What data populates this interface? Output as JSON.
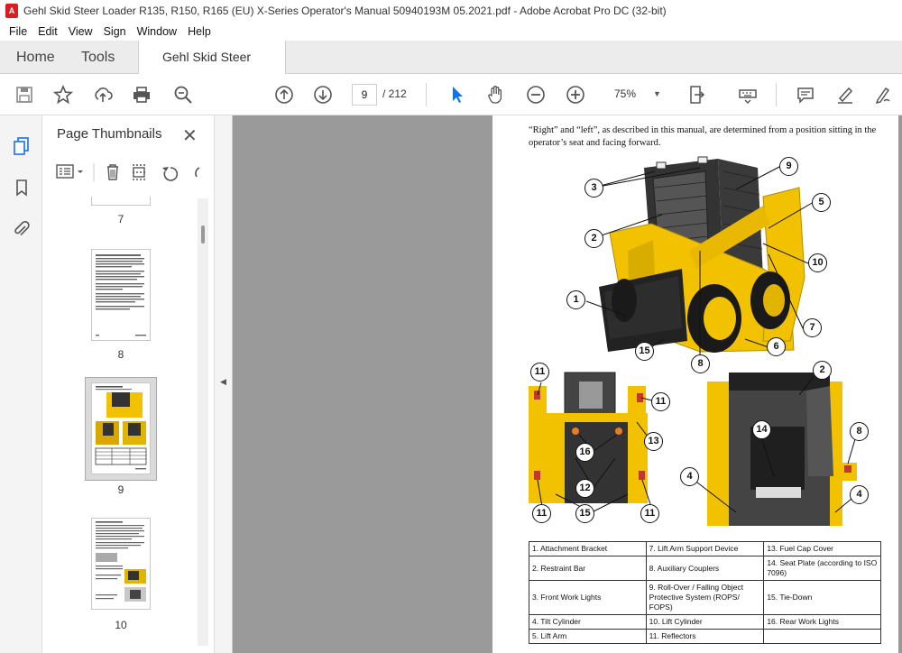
{
  "window": {
    "title": "Gehl Skid Steer Loader R135, R150, R165 (EU) X-Series Operator's Manual 50940193M 05.2021.pdf - Adobe Acrobat Pro DC (32-bit)"
  },
  "menu": [
    "File",
    "Edit",
    "View",
    "Sign",
    "Window",
    "Help"
  ],
  "tabs": {
    "home": "Home",
    "tools": "Tools",
    "document": "Gehl Skid Steer Loa..."
  },
  "toolbar": {
    "current_page": "9",
    "total_pages": "/  212",
    "zoom": "75%"
  },
  "thumbnails": {
    "title": "Page Thumbnails",
    "pages": [
      "7",
      "8",
      "9",
      "10"
    ],
    "selected": "9"
  },
  "document": {
    "intro": "“Right” and “left”, as described in this manual, are determined from a position sitting in the operator’s seat and facing forward.",
    "callouts_top": [
      "3",
      "9",
      "2",
      "5",
      "10",
      "1",
      "7",
      "6",
      "15",
      "8"
    ],
    "callouts_bottom_left": [
      "11",
      "11",
      "13",
      "16",
      "12",
      "11",
      "15",
      "11"
    ],
    "callouts_bottom_right": [
      "2",
      "14",
      "8",
      "4",
      "4"
    ],
    "parts_table": [
      [
        "1. Attachment Bracket",
        "7. Lift Arm Support Device",
        "13. Fuel Cap Cover"
      ],
      [
        "2. Restraint Bar",
        "8. Auxiliary Couplers",
        "14. Seat Plate (according to ISO 7096)"
      ],
      [
        "3. Front Work Lights",
        "9. Roll-Over / Falling Object Protective System (ROPS/ FOPS)",
        "15. Tie-Down"
      ],
      [
        "4. Tilt Cylinder",
        "10. Lift Cylinder",
        "16. Rear Work Lights"
      ],
      [
        "5. Lift Arm",
        "11. Reflectors",
        ""
      ]
    ]
  },
  "colors": {
    "acrobat_red": "#d81e1e",
    "loader_yellow": "#f2c200",
    "doc_background": "#9a9a9a",
    "selection_blue": "#1473e6"
  }
}
